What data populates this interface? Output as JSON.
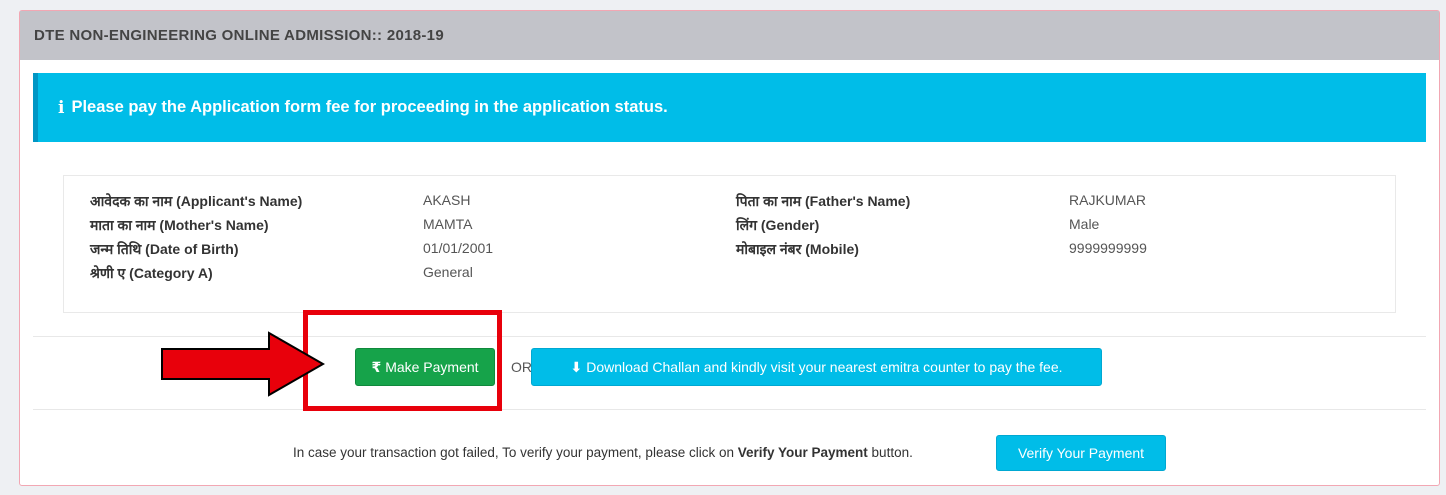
{
  "header": {
    "title": "DTE NON-ENGINEERING ONLINE ADMISSION:: 2018-19"
  },
  "alert": {
    "icon": "info-icon",
    "message": "Please pay the Application form fee for proceeding in the application status."
  },
  "applicant": {
    "name_label": "आवेदक का नाम (Applicant's Name)",
    "name_value": "AKASH",
    "father_label": "पिता का नाम (Father's Name)",
    "father_value": "RAJKUMAR",
    "mother_label": "माता का नाम (Mother's Name)",
    "mother_value": "MAMTA",
    "gender_label": "लिंग (Gender)",
    "gender_value": "Male",
    "dob_label": "जन्म तिथि (Date of Birth)",
    "dob_value": "01/01/2001",
    "mobile_label": "मोबाइल नंबर (Mobile)",
    "mobile_value": "9999999999",
    "category_label": "श्रेणी ए (Category A)",
    "category_value": "General"
  },
  "payment": {
    "rupee_icon": "₹",
    "make_payment_label": "Make Payment",
    "or_text": "OR",
    "download_icon": "⬇",
    "download_challan_label": "Download Challan and kindly visit your nearest emitra counter to pay the fee."
  },
  "verify": {
    "note_prefix": "In case your transaction got failed, To verify your payment, please click on ",
    "note_bold": "Verify Your Payment",
    "note_suffix": " button.",
    "button_label": "Verify Your Payment"
  },
  "colors": {
    "header_bg": "#c2c3c9",
    "info": "#00bde8",
    "success": "#16a34a",
    "annotation_red": "#e8000b"
  }
}
